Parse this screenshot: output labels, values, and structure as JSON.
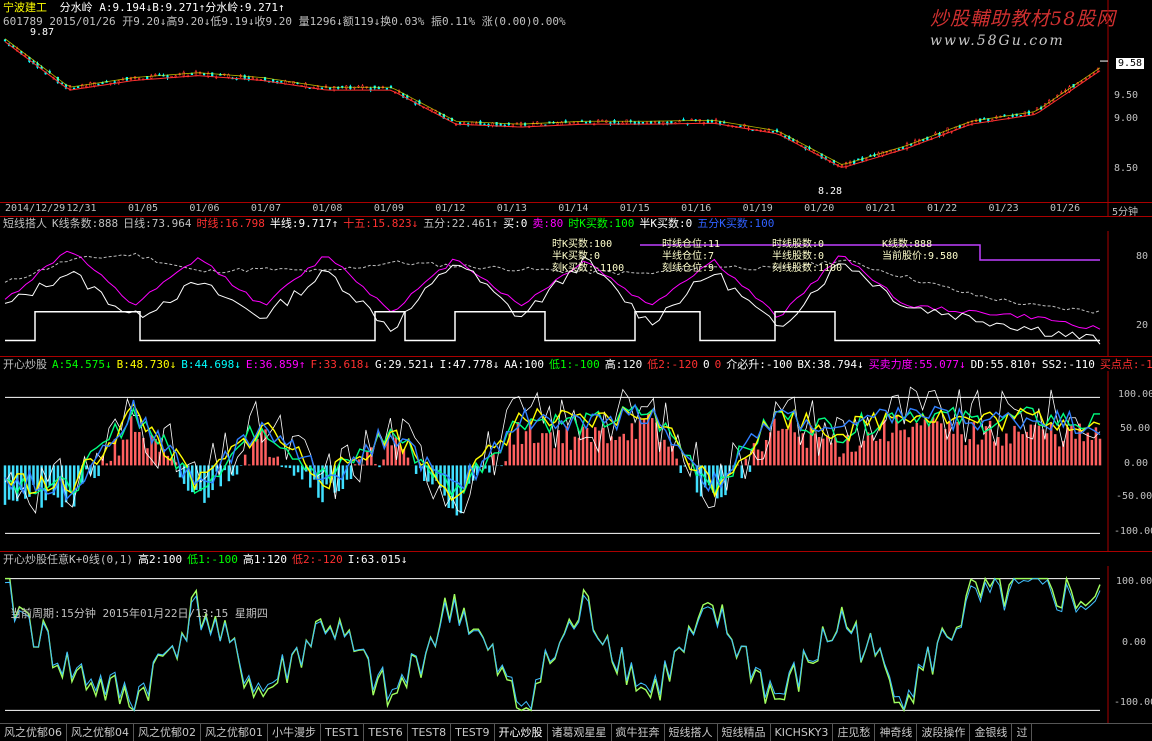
{
  "colors": {
    "bg": "#000000",
    "red": "#ff3030",
    "cyan": "#00ffff",
    "yellow": "#ffff00",
    "white": "#ffffff",
    "green": "#00ff00",
    "magenta": "#ff00ff",
    "pink": "#ff6060",
    "blue": "#3060ff",
    "purple": "#c040ff"
  },
  "watermark": {
    "line1": "炒股輔助教材58股网",
    "line2": "www.58Gu.com"
  },
  "header": {
    "title": "宁波建工",
    "line1_rest": "分水岭 A:9.194↓B:9.271↑分水岭:9.271↑",
    "line2": "601789 2015/01/26 开9.20↓高9.20↓低9.19↓收9.20 量1296↓额119↓换0.03% 振0.11% 涨(0.00)0.00%"
  },
  "main_pane": {
    "annotations": {
      "high": "9.87",
      "low": "8.28",
      "current": "9.58"
    },
    "y_labels": [
      "9.50",
      "9.00",
      "8.50"
    ],
    "period": "5分钟",
    "dates": [
      "2014/12/29",
      "12/31",
      "01/05",
      "01/06",
      "01/07",
      "01/08",
      "01/09",
      "01/12",
      "01/13",
      "01/14",
      "01/15",
      "01/16",
      "01/19",
      "01/20",
      "01/21",
      "01/22",
      "01/23",
      "01/26"
    ]
  },
  "pane2": {
    "header": [
      {
        "t": "短线搭人",
        "c": "#c0c0c0"
      },
      {
        "t": "K线条数:888",
        "c": "#c0c0c0"
      },
      {
        "t": "日线:73.964",
        "c": "#c0c0c0"
      },
      {
        "t": "时线:16.798",
        "c": "#ff3030"
      },
      {
        "t": "半线:9.717↑",
        "c": "#ffffff"
      },
      {
        "t": "十五:15.823↓",
        "c": "#ff3030"
      },
      {
        "t": "五分:22.461↑",
        "c": "#c0c0c0"
      },
      {
        "t": "买:0",
        "c": "#ffffff"
      },
      {
        "t": "卖:80",
        "c": "#ff00ff"
      },
      {
        "t": "时K买数:100",
        "c": "#00ff00"
      },
      {
        "t": "半K买数:0",
        "c": "#ffffff"
      },
      {
        "t": "五分K买数:100",
        "c": "#3060ff"
      }
    ],
    "y_labels": [
      "80",
      "20"
    ],
    "info": [
      [
        "时K买数:100",
        "时线仓位:11",
        "时线股数:0",
        "K线数:888"
      ],
      [
        "半K买数:0",
        "半线仓位:7",
        "半线股数:0",
        "当前股价:9.580"
      ],
      [
        "刻K买数:-1100",
        "刻线仓位:9",
        "刻线股数:1100",
        ""
      ]
    ]
  },
  "pane3": {
    "header": [
      {
        "t": "开心炒股",
        "c": "#c0c0c0"
      },
      {
        "t": "A:54.575↓",
        "c": "#00ff00"
      },
      {
        "t": "B:48.730↓",
        "c": "#ffff00"
      },
      {
        "t": "B:44.698↓",
        "c": "#00ffff"
      },
      {
        "t": "E:36.859↑",
        "c": "#ff00ff"
      },
      {
        "t": "F:33.618↓",
        "c": "#ff3030"
      },
      {
        "t": "G:29.521↓",
        "c": "#ffffff"
      },
      {
        "t": "I:47.778↓",
        "c": "#ffffff"
      },
      {
        "t": "AA:100",
        "c": "#ffffff"
      },
      {
        "t": "低1:-100",
        "c": "#00ff00"
      },
      {
        "t": "高:120",
        "c": "#ffffff"
      },
      {
        "t": "低2:-120",
        "c": "#ff3030"
      },
      {
        "t": "0",
        "c": "#ffffff"
      },
      {
        "t": "0",
        "c": "#ff3030"
      },
      {
        "t": "介必升:-100",
        "c": "#ffffff"
      },
      {
        "t": "BX:38.794↓",
        "c": "#ffffff"
      },
      {
        "t": "买卖力度:55.077↓",
        "c": "#ff00ff"
      },
      {
        "t": "DD:55.810↑",
        "c": "#ffffff"
      },
      {
        "t": "SS2:-110",
        "c": "#ffffff"
      },
      {
        "t": "买点点:-1",
        "c": "#ff3030"
      }
    ],
    "y_labels": [
      "100.00",
      "50.00",
      "0.00",
      "-50.00",
      "-100.00"
    ]
  },
  "pane4": {
    "header": [
      {
        "t": "开心炒股任意K+0线(0,1)",
        "c": "#c0c0c0"
      },
      {
        "t": "高2:100",
        "c": "#ffffff"
      },
      {
        "t": "低1:-100",
        "c": "#00ff00"
      },
      {
        "t": "高1:120",
        "c": "#ffffff"
      },
      {
        "t": "低2:-120",
        "c": "#ff3030"
      },
      {
        "t": "I:63.015↓",
        "c": "#ffffff"
      }
    ],
    "overlay": "当前周期:15分钟 2015年01月22日/13:15 星期四",
    "y_labels": [
      "100.00",
      "0.00",
      "-100.00"
    ]
  },
  "tabs": [
    "风之优郁06",
    "风之优郁04",
    "风之优郁02",
    "风之优郁01",
    "小牛漫步",
    "TEST1",
    "TEST6",
    "TEST8",
    "TEST9",
    "开心炒股",
    "诸葛观星星",
    "疯牛狂奔",
    "短线搭人",
    "短线精品",
    "KICHSKY3",
    "庄见愁",
    "神奇线",
    "波段操作",
    "金银线",
    "过"
  ],
  "chart_data": [
    {
      "type": "line",
      "title": "宁波建工",
      "x": [
        "2014/12/29",
        "12/31",
        "01/05",
        "01/06",
        "01/07",
        "01/08",
        "01/09",
        "01/12",
        "01/13",
        "01/14",
        "01/15",
        "01/16",
        "01/19",
        "01/20",
        "01/21",
        "01/22",
        "01/23",
        "01/26"
      ],
      "series": [
        {
          "name": "",
          "values": [
            9.8,
            9.3,
            9.4,
            9.45,
            9.4,
            9.3,
            9.3,
            8.95,
            8.92,
            8.95,
            8.95,
            8.96,
            8.85,
            8.5,
            8.7,
            8.95,
            9.05,
            9.5
          ]
        }
      ],
      "ylim": [
        8.2,
        9.9
      ],
      "high": 9.87,
      "low": 8.28,
      "last": 9.58
    },
    {
      "type": "line",
      "title": "短线搭人",
      "ylim": [
        0,
        100
      ],
      "series": [
        {
          "name": "日线",
          "values": [
            60,
            80,
            85,
            70,
            72,
            70,
            78,
            75,
            72,
            70,
            68,
            75,
            72,
            80,
            65,
            50,
            40,
            35
          ]
        },
        {
          "name": "时线",
          "values": [
            45,
            90,
            40,
            82,
            40,
            85,
            35,
            82,
            40,
            80,
            40,
            80,
            30,
            85,
            40,
            35,
            30,
            20
          ]
        },
        {
          "name": "半线",
          "values": [
            40,
            70,
            30,
            60,
            30,
            70,
            20,
            80,
            30,
            80,
            25,
            70,
            20,
            80,
            40,
            30,
            20,
            10
          ]
        }
      ]
    },
    {
      "type": "bar",
      "title": "开心炒股",
      "ylim": [
        -120,
        130
      ],
      "series": [
        {
          "name": "买卖力度",
          "values": [
            -40,
            -55,
            60,
            -50,
            40,
            -40,
            30,
            -60,
            50,
            40,
            60,
            -50,
            55,
            30,
            60,
            45,
            50,
            40
          ]
        }
      ]
    },
    {
      "type": "line",
      "title": "开心炒股任意K+0线(0,1)",
      "ylim": [
        -110,
        110
      ],
      "series": [
        {
          "name": "I",
          "values": [
            80,
            -40,
            -90,
            60,
            -80,
            40,
            -90,
            70,
            -100,
            60,
            -80,
            50,
            -90,
            40,
            -80,
            70,
            90,
            63
          ]
        }
      ]
    }
  ]
}
